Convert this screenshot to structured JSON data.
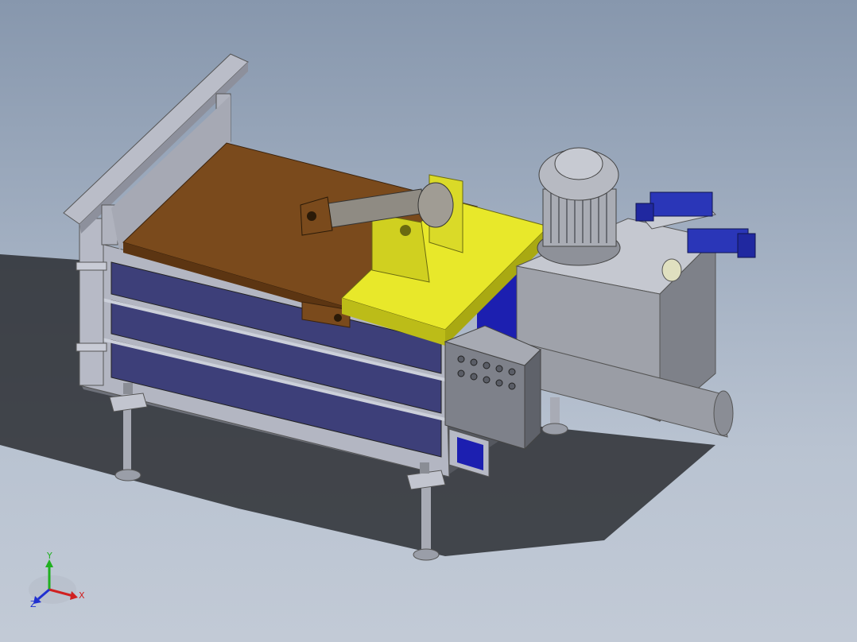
{
  "viewport": {
    "background_top": "#8797ad",
    "background_bottom": "#c2cad6"
  },
  "model": {
    "colors": {
      "frame_gray": "#b9bdc9",
      "frame_dark": "#8d909c",
      "side_panel_blue": "#3c3f7a",
      "wood_plate": "#7a4a1c",
      "yellow_plate": "#e6e62a",
      "motor_gray": "#a0a3ab",
      "valve_blue": "#2a36b8",
      "control_box": "#7e818a"
    },
    "control_box_buttons": 10
  },
  "triad": {
    "x_label": "X",
    "y_label": "Y",
    "z_label": "Z",
    "x_color": "#d02020",
    "y_color": "#20b020",
    "z_color": "#2030d0"
  }
}
